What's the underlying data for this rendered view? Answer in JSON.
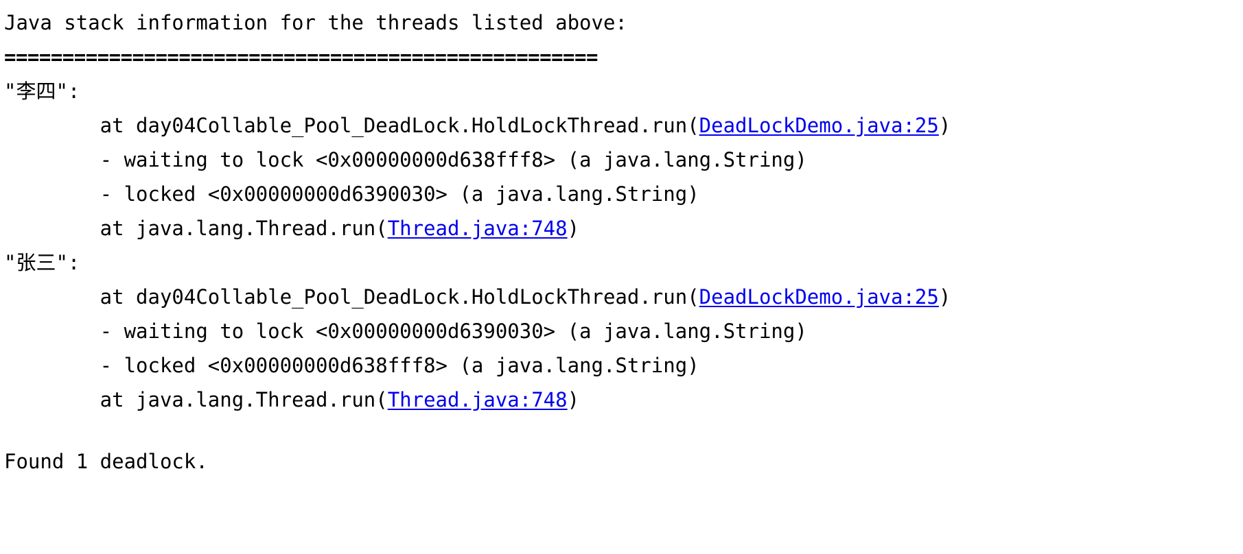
{
  "console": {
    "header": "Java stack information for the threads listed above:",
    "separator": "===================================================",
    "threads": [
      {
        "name": "\"李四\":",
        "frames": [
          {
            "type": "at",
            "prefix": "        at day04Collable_Pool_DeadLock.HoldLockThread.run(",
            "link": "DeadLockDemo.java:25",
            "suffix": ")"
          },
          {
            "type": "lock",
            "prefix": "        - waiting to lock <0x00000000d638fff8> (a java.lang.String)",
            "link": "",
            "suffix": ""
          },
          {
            "type": "lock",
            "prefix": "        - locked <0x00000000d6390030> (a java.lang.String)",
            "link": "",
            "suffix": ""
          },
          {
            "type": "at",
            "prefix": "        at java.lang.Thread.run(",
            "link": "Thread.java:748",
            "suffix": ")"
          }
        ]
      },
      {
        "name": "\"张三\":",
        "frames": [
          {
            "type": "at",
            "prefix": "        at day04Collable_Pool_DeadLock.HoldLockThread.run(",
            "link": "DeadLockDemo.java:25",
            "suffix": ")"
          },
          {
            "type": "lock",
            "prefix": "        - waiting to lock <0x00000000d6390030> (a java.lang.String)",
            "link": "",
            "suffix": ""
          },
          {
            "type": "lock",
            "prefix": "        - locked <0x00000000d638fff8> (a java.lang.String)",
            "link": "",
            "suffix": ""
          },
          {
            "type": "at",
            "prefix": "        at java.lang.Thread.run(",
            "link": "Thread.java:748",
            "suffix": ")"
          }
        ]
      }
    ],
    "blank_line": "",
    "footer": "Found 1 deadlock."
  }
}
